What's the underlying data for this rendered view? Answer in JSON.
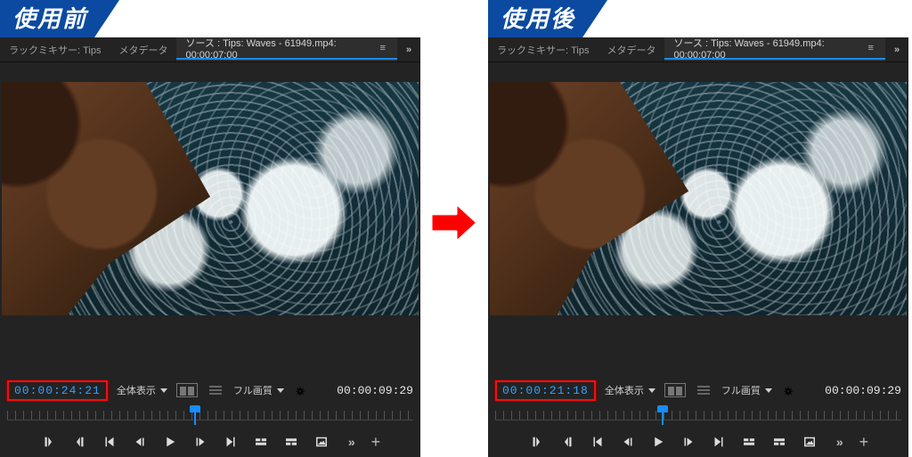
{
  "labels": {
    "before": "使用前",
    "after": "使用後"
  },
  "tabs": {
    "trackMixer": "ラックミキサー: Tips",
    "metadata": "メタデータ"
  },
  "source": {
    "prefix": "ソース",
    "tabText": "ソース : Tips: Waves - 61949.mp4: 00:00:07:00"
  },
  "dropdown": {
    "fit": "全体表示",
    "quality": "フル画質"
  },
  "tc": {
    "before_current": "00:00:24:21",
    "after_current": "00:00:21:18",
    "duration": "00:00:09:29"
  },
  "icons": {
    "overflow": "»",
    "plus": "+"
  }
}
